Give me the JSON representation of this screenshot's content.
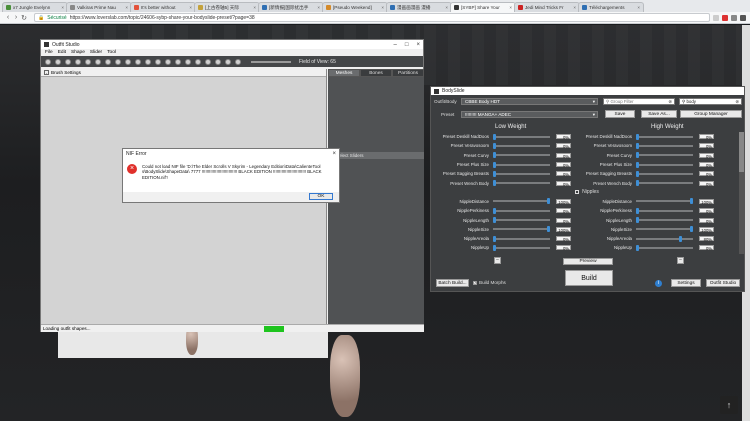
{
  "browser": {
    "tabs": [
      {
        "label": "x7 Jungle Evelynn",
        "color": "#4a8f3a"
      },
      {
        "label": "Valkiras Prime Nau",
        "color": "#888888"
      },
      {
        "label": "It's better without",
        "color": "#e3513a"
      },
      {
        "label": "[上古卷轴5] 天际",
        "color": "#c4a23c"
      },
      {
        "label": "[新情报]国际扰出手",
        "color": "#2f6fb3"
      },
      {
        "label": "[Pseudo Weekend]",
        "color": "#d48a2a"
      },
      {
        "label": "漫画画漫画 漫播",
        "color": "#2f6fb3"
      },
      {
        "label": "[SYBP] Share Your",
        "color": "#333333",
        "active": true
      },
      {
        "label": "Jedi Mind Tricks Fr",
        "color": "#cc2222"
      },
      {
        "label": "Téléchargements",
        "color": "#2f6fb3"
      }
    ],
    "secure_label": "Sécurisé",
    "url": "https://www.loverslab.com/topic/24606-sybp-share-your-bodyslide-preset/?page=38"
  },
  "outfit_studio": {
    "title": "Outfit Studio",
    "menu": [
      "File",
      "Edit",
      "Shape",
      "Slider",
      "Tool"
    ],
    "fov_label": "Field of View: 65",
    "tabs": [
      "Meshes",
      "Bones",
      "Partitions"
    ],
    "brush_settings": "Brush Settings",
    "select_sliders": "Select Sliders",
    "status": "Loading outfit shapes..."
  },
  "nif_error": {
    "title": "NIF Error",
    "message": "Could not load NIF file 'D:\\The Elder Scrolls V Skyrim - Legendary Edition\\Data\\CalienteTools\\BodySlide\\ShapeData\\ 7777 !!!!!!!!!!!!!!!!!!!!!!!!!!!!! BLACK EDITION !!!!!!!!!!!!!!!!!!!!!!!!!!! BLACK EDITION.nif'!",
    "ok": "OK"
  },
  "bodyslide": {
    "title": "BodySlide",
    "outfit_label": "Outfit/Body",
    "outfit_value": "CBBE Body HDT",
    "group_filter_placeholder": "Group Filter",
    "outfit_filter_value": "body",
    "preset_label": "Preset",
    "preset_value": "!!!!!!!!! MANGA+ ADEC",
    "save": "Save",
    "save_as": "Save As...",
    "group_manager": "Group Manager",
    "low_weight": "Low Weight",
    "high_weight": "High Weight",
    "rows_top": [
      {
        "label": "Preset Deskill NadDoos",
        "low": "0%",
        "high": "0%",
        "lowpos": 0.0,
        "highpos": 0.0
      },
      {
        "label": "Preset Veravosoom",
        "low": "0%",
        "high": "0%",
        "lowpos": 0.0,
        "highpos": 0.0
      },
      {
        "label": "Preset Curvy",
        "low": "0%",
        "high": "0%",
        "lowpos": 0.0,
        "highpos": 0.0
      },
      {
        "label": "Preset Plus Size",
        "low": "0%",
        "high": "0%",
        "lowpos": 0.0,
        "highpos": 0.0
      },
      {
        "label": "Preset Sagging Breasts",
        "low": "0%",
        "high": "0%",
        "lowpos": 0.0,
        "highpos": 0.0
      },
      {
        "label": "Preset Wench Body",
        "low": "0%",
        "high": "0%",
        "lowpos": 0.0,
        "highpos": 0.0
      }
    ],
    "nipples_header": "Nipples",
    "rows_nipples": [
      {
        "label": "NippleDistance",
        "low": "100%",
        "high": "100%",
        "lowpos": 1.0,
        "highpos": 1.0
      },
      {
        "label": "NipplePerkiness",
        "low": "0%",
        "high": "0%",
        "lowpos": 0.0,
        "highpos": 0.0
      },
      {
        "label": "NippleLength",
        "low": "0%",
        "high": "0%",
        "lowpos": 0.0,
        "highpos": 0.0
      },
      {
        "label": "NippleSize",
        "low": "100%",
        "high": "100%",
        "lowpos": 1.0,
        "highpos": 1.0
      },
      {
        "label": "NippleAreola",
        "low": "0%",
        "high": "80%",
        "lowpos": 0.0,
        "highpos": 0.8
      },
      {
        "label": "NippleUp",
        "low": "0%",
        "high": "0%",
        "lowpos": 0.0,
        "highpos": 0.0
      }
    ],
    "preview": "Preview",
    "build": "Build",
    "batch_build": "Batch Build...",
    "build_morphs": "Build Morphs",
    "settings": "Settings",
    "outfit_studio_btn": "Outfit Studio",
    "info_icon": "info-icon"
  }
}
